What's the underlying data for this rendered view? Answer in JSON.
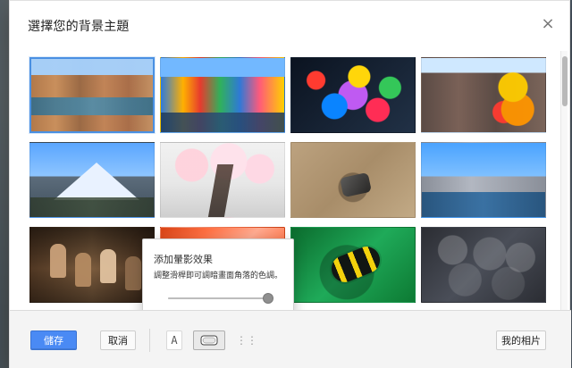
{
  "dialog": {
    "title": "選擇您的背景主題",
    "close_label": "×"
  },
  "grid": {
    "selected_index": 0,
    "tiles": [
      {
        "style": "photo-city"
      },
      {
        "style": "photo-colorful"
      },
      {
        "style": "photo-glass"
      },
      {
        "style": "photo-castle"
      },
      {
        "style": "photo-mountain"
      },
      {
        "style": "photo-blossom"
      },
      {
        "style": "photo-desert"
      },
      {
        "style": "photo-river"
      },
      {
        "style": "photo-chess"
      },
      {
        "style": "photo-fireflower"
      },
      {
        "style": "photo-caterpillar"
      },
      {
        "style": "photo-pipes"
      }
    ]
  },
  "tooltip": {
    "title": "添加暈影效果",
    "description": "調整滑桿即可調暗畫面角落的色調。",
    "slider_level": 1.0
  },
  "footer": {
    "save_label": "儲存",
    "cancel_label": "取消",
    "text_icon_label": "A",
    "vignette_icon_label": "",
    "grid_icon_label": "⋮⋮",
    "my_photos_label": "我的相片"
  },
  "colors": {
    "primary_button": "#4a8af4",
    "selected_outline": "#4a90e2"
  }
}
